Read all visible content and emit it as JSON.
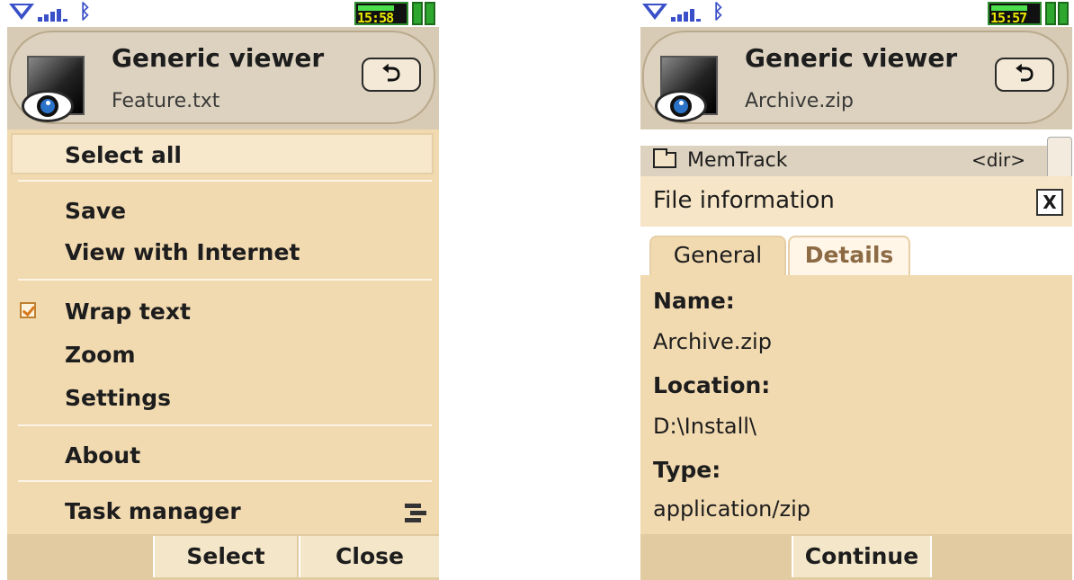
{
  "left": {
    "clock": "15:58",
    "header": {
      "title": "Generic viewer",
      "file": "Feature.txt",
      "back_symbol": "⮌"
    },
    "menu": {
      "items": [
        {
          "label": "Select all"
        },
        {
          "label": "Save"
        },
        {
          "label": "View with Internet"
        },
        {
          "label": "Wrap text",
          "checked": true
        },
        {
          "label": "Zoom"
        },
        {
          "label": "Settings"
        },
        {
          "label": "About"
        },
        {
          "label": "Task manager"
        }
      ]
    },
    "softkeys": {
      "select": "Select",
      "close": "Close"
    }
  },
  "right": {
    "clock": "15:57",
    "header": {
      "title": "Generic viewer",
      "file": "Archive.zip",
      "back_symbol": "⮌"
    },
    "list_row": {
      "name": "MemTrack",
      "meta": "<dir>"
    },
    "dialog": {
      "title": "File information",
      "close": "X",
      "tabs": [
        "General",
        "Details"
      ],
      "fields": [
        {
          "label": "Name:",
          "value": "Archive.zip"
        },
        {
          "label": "Location:",
          "value": "D:\\Install\\"
        },
        {
          "label": "Type:",
          "value": "application/zip"
        }
      ]
    },
    "softkeys": {
      "continue": "Continue"
    }
  },
  "colors": {
    "menu_bg": "#f1d9b0",
    "header_bg": "#d8cbb5",
    "status_blue": "#3a50c8",
    "battery_green": "#2ea72e"
  },
  "icons": [
    "signal-icon",
    "bluetooth-icon",
    "battery-icon",
    "back-icon",
    "viewer-eye-icon",
    "checkbox-icon",
    "task-manager-icon",
    "folder-icon"
  ]
}
